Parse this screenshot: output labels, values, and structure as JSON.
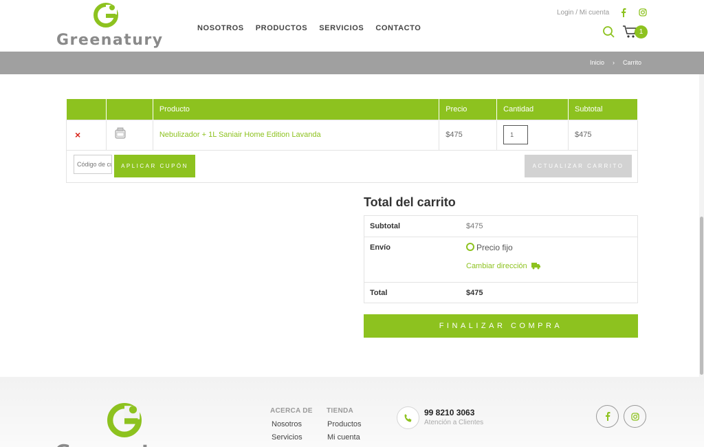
{
  "brand": {
    "name": "Greenatury",
    "accent": "#8dc21f"
  },
  "nav": {
    "items": [
      "NOSOTROS",
      "PRODUCTOS",
      "SERVICIOS",
      "CONTACTO"
    ]
  },
  "header": {
    "login": "Login / Mi cuenta",
    "cart_count": "1"
  },
  "breadcrumb": {
    "home": "Inicio",
    "separator": "›",
    "current": "Carrito"
  },
  "cart": {
    "headers": {
      "product": "Producto",
      "price": "Precio",
      "quantity": "Cantidad",
      "subtotal": "Subtotal"
    },
    "items": [
      {
        "remove": "×",
        "name": "Nebulizador + 1L Saniair Home Edition Lavanda",
        "price": "$475",
        "quantity": "1",
        "subtotal": "$475"
      }
    ],
    "coupon_placeholder": "Código de cupón",
    "apply_label": "APLICAR CUPÓN",
    "update_label": "ACTUALIZAR CARRITO"
  },
  "totals": {
    "title": "Total del carrito",
    "subtotal_label": "Subtotal",
    "subtotal_value": "$475",
    "shipping_label": "Envío",
    "shipping_option": "Precio fijo",
    "change_address": "Cambiar dirección",
    "total_label": "Total",
    "total_value": "$475",
    "checkout_label": "FINALIZAR COMPRA"
  },
  "footer": {
    "col1": {
      "title": "ACERCA DE",
      "items": [
        "Nosotros",
        "Servicios"
      ]
    },
    "col2": {
      "title": "TIENDA",
      "items": [
        "Productos",
        "Mi cuenta"
      ]
    },
    "phone": "99 8210 3063",
    "phone_caption": "Atención a Clientes"
  },
  "icons": {
    "logo": "greenatury-g-logo",
    "facebook": "facebook-icon",
    "instagram": "instagram-icon",
    "search": "search-icon",
    "cart": "cart-icon",
    "phone": "phone-icon",
    "truck": "truck-icon"
  }
}
